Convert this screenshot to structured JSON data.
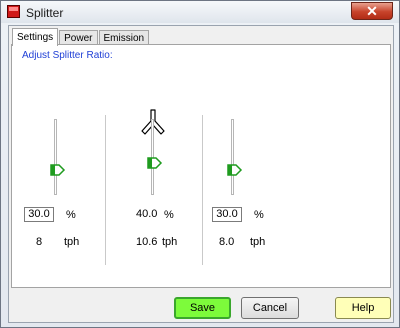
{
  "window": {
    "title": "Splitter",
    "close_glyph": "✕"
  },
  "tabs": [
    {
      "label": "Settings",
      "active": true
    },
    {
      "label": "Power",
      "active": false
    },
    {
      "label": "Emission",
      "active": false
    }
  ],
  "panel": {
    "caption": "Adjust Splitter Ratio:"
  },
  "outputs": [
    {
      "percent": "30.0",
      "percent_unit": "%",
      "flow": "8",
      "flow_unit": "tph",
      "editable": true
    },
    {
      "percent": "40.0",
      "percent_unit": "%",
      "flow": "10.6",
      "flow_unit": "tph",
      "editable": false
    },
    {
      "percent": "30.0",
      "percent_unit": "%",
      "flow": "8.0",
      "flow_unit": "tph",
      "editable": true
    }
  ],
  "buttons": {
    "save": "Save",
    "cancel": "Cancel",
    "help": "Help"
  },
  "colors": {
    "save_bg": "#7dfb3b",
    "help_bg": "#ffffb8",
    "thumb": "#1f9b1f",
    "caption": "#1f3fd6"
  },
  "icons": {
    "splitter": "splitter-y-icon",
    "thumb": "slider-thumb-icon"
  }
}
